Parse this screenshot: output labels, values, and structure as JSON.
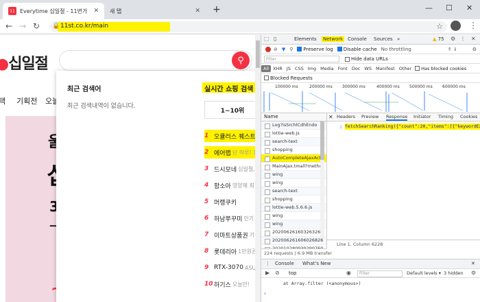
{
  "browser": {
    "tabs": [
      {
        "favicon": "11",
        "title": "Everytime 십일절 - 11번가"
      },
      {
        "title": "새 탭"
      }
    ],
    "url": "11st.co.kr/main"
  },
  "site": {
    "logo": "십일절",
    "nav": [
      "택",
      "기획전",
      "오늘"
    ],
    "banner": {
      "top": "울",
      "big": "십",
      "num": "3",
      "line": "—",
      "bottom": "~"
    },
    "dropdown": {
      "recent_title": "최근 검색어",
      "recent_empty": "최근 검색내역이 없습니다.",
      "realtime_title": "실시간 쇼핑 검색",
      "range": "1~10위",
      "ranks": [
        {
          "n": "1",
          "kw": "오큘러스 퀘스트",
          "sub": ""
        },
        {
          "n": "2",
          "kw": "에어랩",
          "sub": "단 하루! 1"
        },
        {
          "n": "3",
          "kw": "드시모네",
          "sub": "십일절,"
        },
        {
          "n": "4",
          "kw": "함소아",
          "sub": "영양제 최"
        },
        {
          "n": "5",
          "kw": "머랭쿠키",
          "sub": ""
        },
        {
          "n": "6",
          "kw": "하남쭈꾸미",
          "sub": "인기"
        },
        {
          "n": "7",
          "kw": "이마트상품권",
          "sub": "기"
        },
        {
          "n": "8",
          "kw": "롯데리아",
          "sub": "1만원권"
        },
        {
          "n": "9",
          "kw": "RTX-3070",
          "sub": "ASUS"
        },
        {
          "n": "10",
          "kw": "하기스",
          "sub": "오늘만!"
        }
      ]
    }
  },
  "devtools": {
    "tabs": [
      "Elements",
      "Network",
      "Console",
      "Sources",
      "»"
    ],
    "warnings": "75",
    "toolbar": {
      "preserve_log": "Preserve log",
      "disable_cache": "Disable cache",
      "throttle": "No throttling"
    },
    "filter_placeholder": "Filter",
    "hide_data_urls": "Hide data URLs",
    "types": [
      "All",
      "XHR",
      "JS",
      "CSS",
      "Img",
      "Media",
      "Font",
      "Doc",
      "WS",
      "Manifest",
      "Other"
    ],
    "has_blocked_cookies": "Has blocked cookies",
    "blocked_requests": "Blocked Requests",
    "timeline_labels": [
      "100000 ms",
      "200000 ms",
      "300000 ms",
      "400000 ms",
      "500000 ms",
      "600000 ms"
    ],
    "name_header": "Name",
    "requests": [
      "Log?isSrchlCdhEndo",
      "lottie-web.js",
      "search-text",
      "shopping",
      "AutoCompleteAjaxActi",
      "MainAjax.tmall?metho",
      "wing",
      "wing",
      "search-text",
      "shopping",
      "lottie-web.5.6.6.js",
      "wing",
      "wing",
      "202006261603263264",
      "202006261606026826",
      "202010280939290760"
    ],
    "detail_tabs": [
      "Headers",
      "Preview",
      "Response",
      "Initiator",
      "Timing",
      "Cookies"
    ],
    "line_no": "1",
    "response_code": "fetchSearchRanking({\"count\":20,\"items\":[{\"keywordExter",
    "cursor": "Line 1, Column 6228",
    "status": "224 requests  |  6.9 MB transfer",
    "drawer_tabs": [
      "Console",
      "What's New"
    ],
    "console_context": "top",
    "console_filter": "Filter",
    "default_levels": "Default levels ▾",
    "hidden": "3 hidden",
    "console_line": "at Array.filter (<anonymous>)"
  }
}
